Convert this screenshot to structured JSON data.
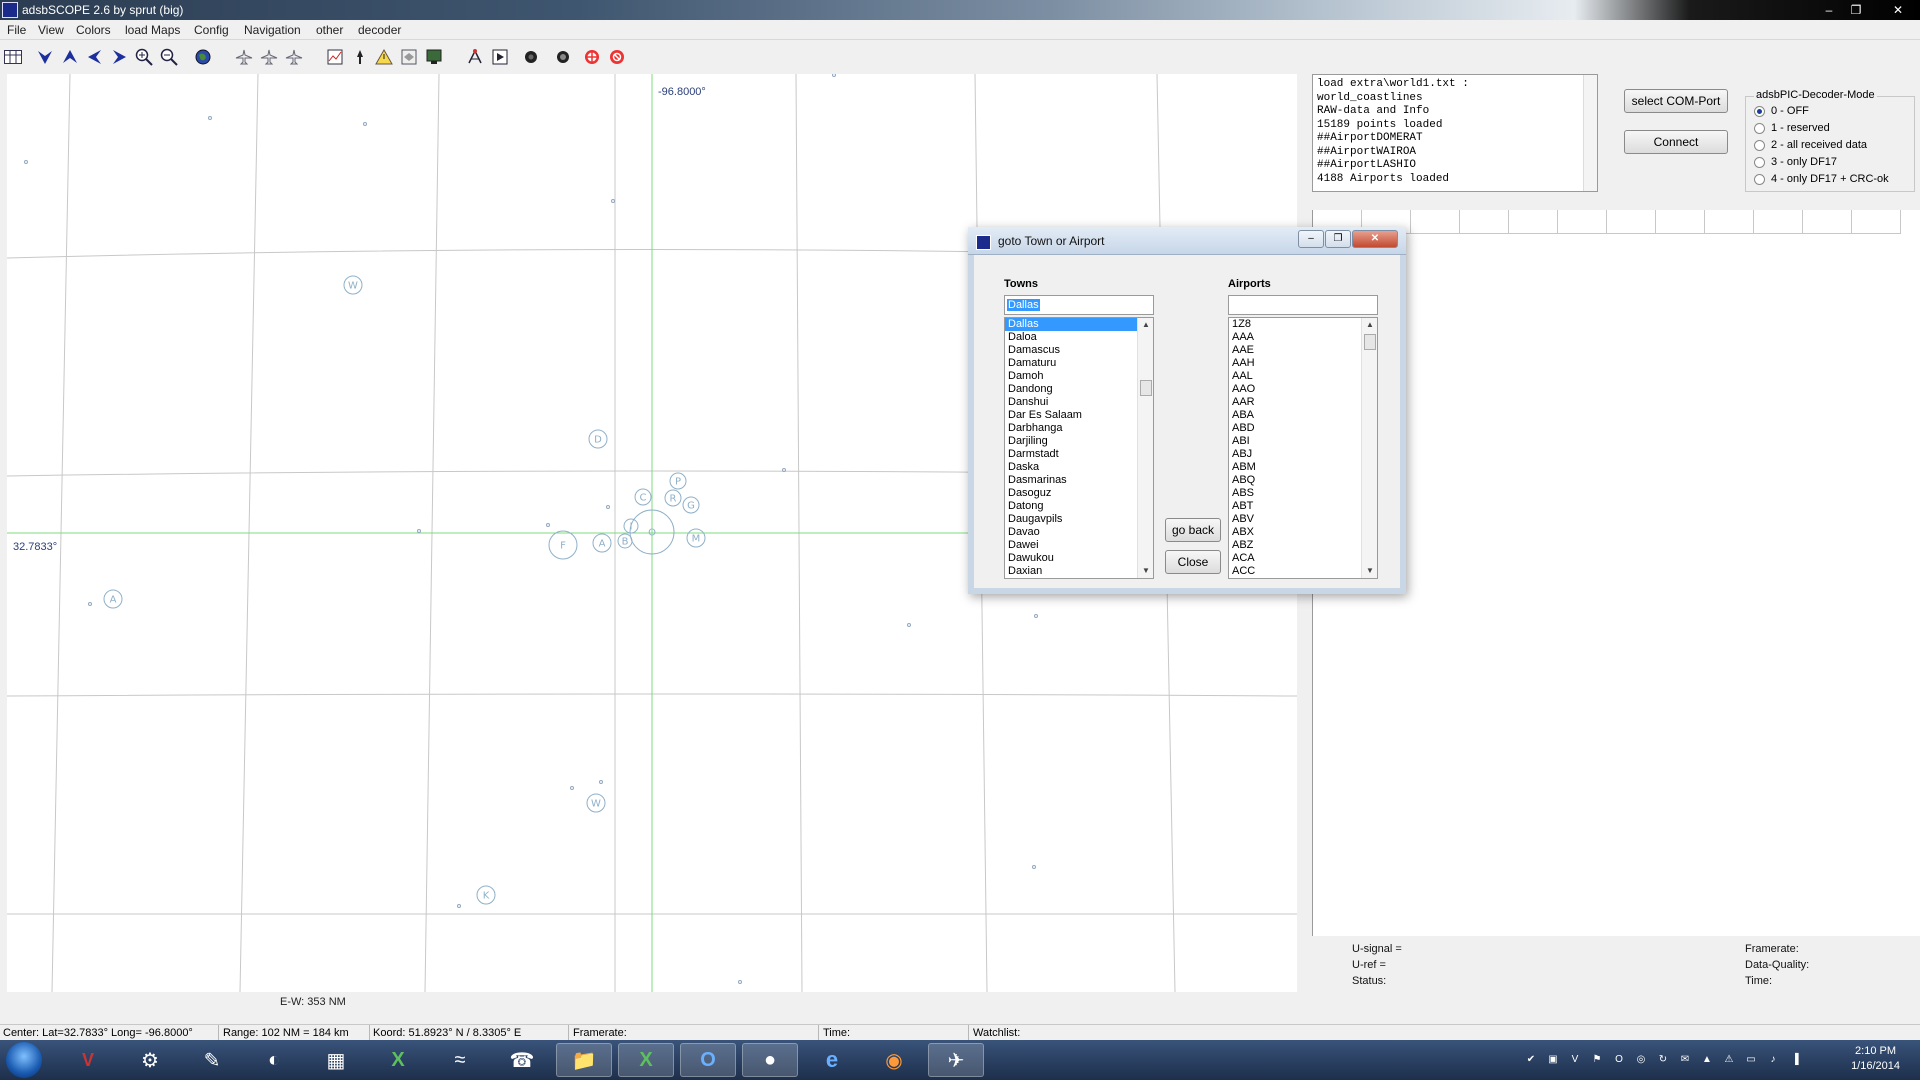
{
  "window": {
    "title": "adsbSCOPE 2.6 by sprut  (big)"
  },
  "menu": [
    "File",
    "View",
    "Colors",
    "load Maps",
    "Config",
    "Navigation",
    "other",
    "decoder"
  ],
  "map": {
    "longitude_label": "-96.8000°",
    "latitude_label": "32.7833°",
    "scale_label": "E-W: 353 NM",
    "airport_markers": [
      "W",
      "D",
      "P",
      "C",
      "R",
      "G",
      "F",
      "A",
      "B",
      "I",
      "O",
      "M",
      "A",
      "W",
      "K"
    ]
  },
  "log": {
    "lines": [
      "load extra\\world1.txt :",
      "world_coastlines",
      "RAW-data and Info",
      "15189 points loaded",
      "##AirportDOMERAT",
      "##AirportWAIROA",
      "##AirportLASHIO",
      "4188 Airports loaded"
    ]
  },
  "buttons": {
    "select_com": "select COM-Port",
    "connect": "Connect"
  },
  "decoder_mode": {
    "legend": "adsbPIC-Decoder-Mode",
    "options": [
      "0 - OFF",
      "1 - reserved",
      "2 - all received data",
      "3 - only DF17",
      "4 - only DF17 + CRC-ok"
    ],
    "selected_index": 0
  },
  "signal_info": {
    "u_signal": "U-signal =",
    "u_ref": "U-ref =",
    "status": "Status:",
    "framerate": "Framerate:",
    "data_quality": "Data-Quality:",
    "time": "Time:"
  },
  "dialog": {
    "title": "goto Town or Airport",
    "towns_label": "Towns",
    "airports_label": "Airports",
    "town_input": "Dallas",
    "airport_input": "",
    "towns": [
      "Dallas",
      "Daloa",
      "Damascus",
      "Damaturu",
      "Damoh",
      "Dandong",
      "Danshui",
      "Dar Es Salaam",
      "Darbhanga",
      "Darjiling",
      "Darmstadt",
      "Daska",
      "Dasmarinas",
      "Dasoguz",
      "Datong",
      "Daugavpils",
      "Davao",
      "Dawei",
      "Dawukou",
      "Daxian"
    ],
    "selected_town_index": 0,
    "airports": [
      "1Z8",
      "AAA",
      "AAE",
      "AAH",
      "AAL",
      "AAO",
      "AAR",
      "ABA",
      "ABD",
      "ABI",
      "ABJ",
      "ABM",
      "ABQ",
      "ABS",
      "ABT",
      "ABV",
      "ABX",
      "ABZ",
      "ACA",
      "ACC"
    ],
    "go_back": "go back",
    "close": "Close"
  },
  "statusbar": {
    "center": "Center: Lat=32.7833° Long= -96.8000°",
    "range": "Range: 102 NM = 184 km",
    "koord": "Koord: 51.8923° N / 8.3305° E",
    "framerate": "Framerate:",
    "time": "Time:",
    "watchlist": "Watchlist:"
  },
  "clock": {
    "time": "2:10 PM",
    "date": "1/16/2014"
  },
  "colors": {
    "crosshair": "#7ddc7d",
    "grid": "#c8c8c8",
    "marker": "#8fb0c8",
    "selection": "#3399ff"
  }
}
